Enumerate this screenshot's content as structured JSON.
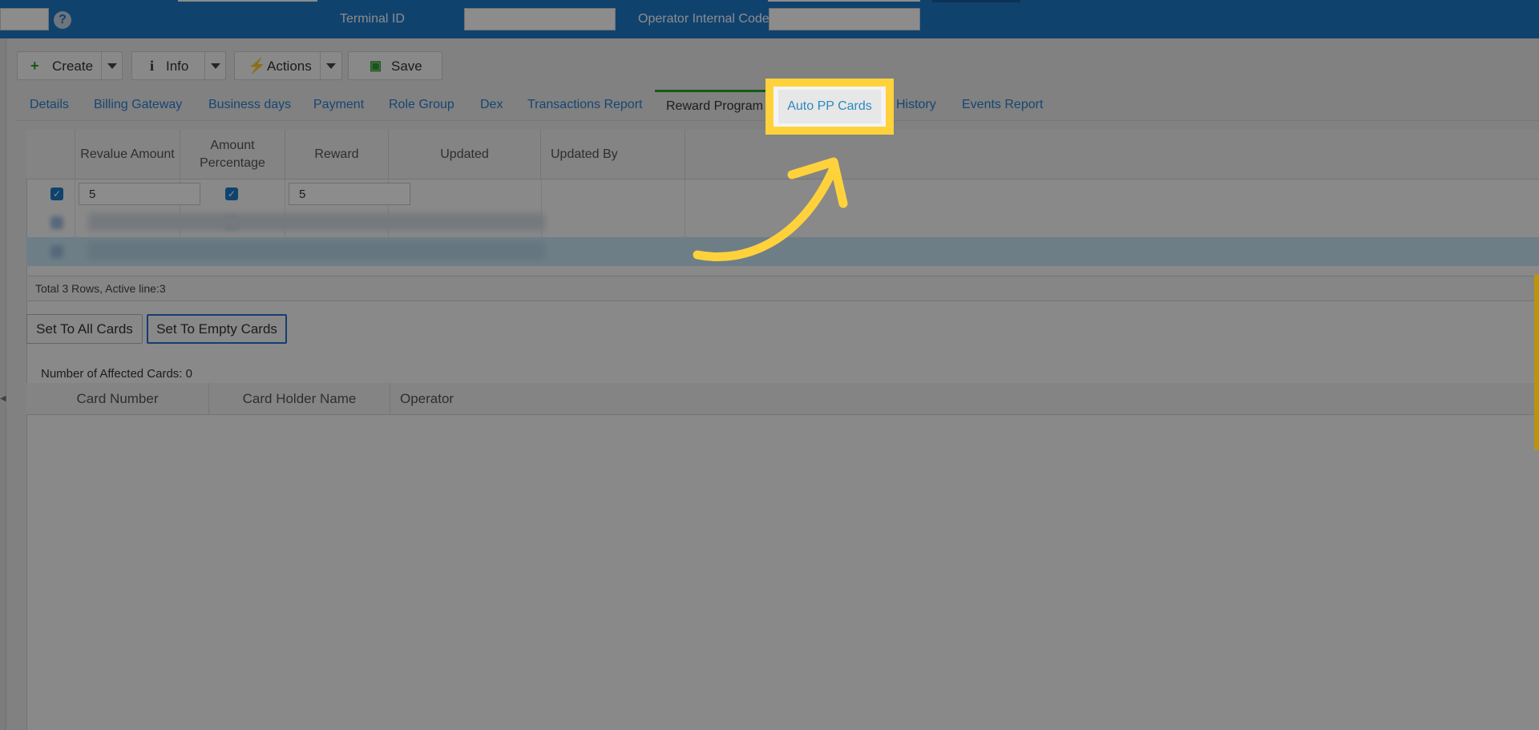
{
  "header": {
    "terminal_id_label": "Terminal ID",
    "operator_code_label": "Operator Internal Code",
    "help_icon": "?"
  },
  "toolbar": {
    "create_label": "Create",
    "info_label": "Info",
    "actions_label": "Actions",
    "save_label": "Save"
  },
  "tabs": [
    {
      "label": "Details"
    },
    {
      "label": "Billing Gateway"
    },
    {
      "label": "Business days"
    },
    {
      "label": "Payment"
    },
    {
      "label": "Role Group"
    },
    {
      "label": "Dex"
    },
    {
      "label": "Transactions Report"
    },
    {
      "label": "Reward Program"
    },
    {
      "label": "Auto PP Cards"
    },
    {
      "label": "History"
    },
    {
      "label": "Events Report"
    }
  ],
  "reward_grid": {
    "columns": [
      "",
      "Revalue Amount",
      "Amount Percentage",
      "Reward",
      "Updated",
      "Updated By"
    ],
    "rows": [
      {
        "revalue_amount": "5",
        "reward": "5"
      }
    ],
    "footer": "Total 3 Rows, Active line:3"
  },
  "buttons": {
    "set_all": "Set To All Cards",
    "set_empty": "Set To Empty Cards"
  },
  "affected_label": "Number of Affected Cards: 0",
  "cards_grid": {
    "columns": [
      "Card Number",
      "Card Holder Name",
      "Operator"
    ]
  },
  "colors": {
    "header_blue": "#1e79c8",
    "highlight": "#ffd23c",
    "tab_link": "#2a7fd1",
    "active_tab_line": "#2aa32a"
  }
}
